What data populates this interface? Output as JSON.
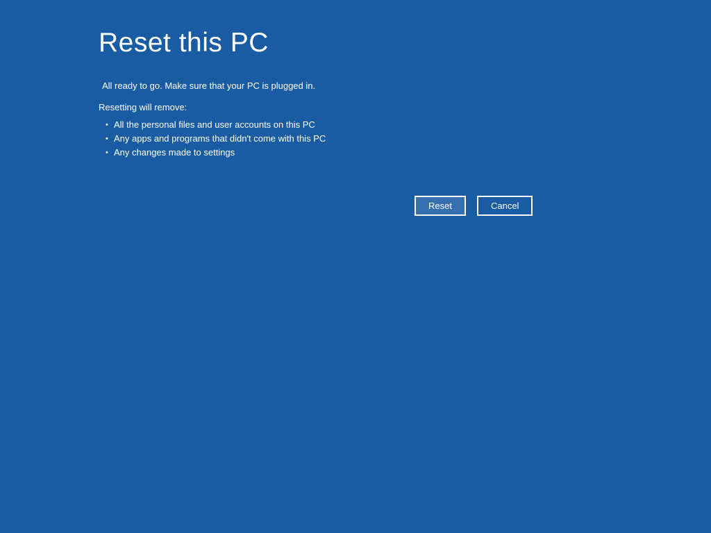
{
  "title": "Reset this PC",
  "status": "All ready to go. Make sure that your PC is plugged in.",
  "listHeading": "Resetting will remove:",
  "items": [
    "All the personal files and user accounts on this PC",
    "Any apps and programs that didn't come with this PC",
    "Any changes made to settings"
  ],
  "buttons": {
    "reset": "Reset",
    "cancel": "Cancel"
  }
}
